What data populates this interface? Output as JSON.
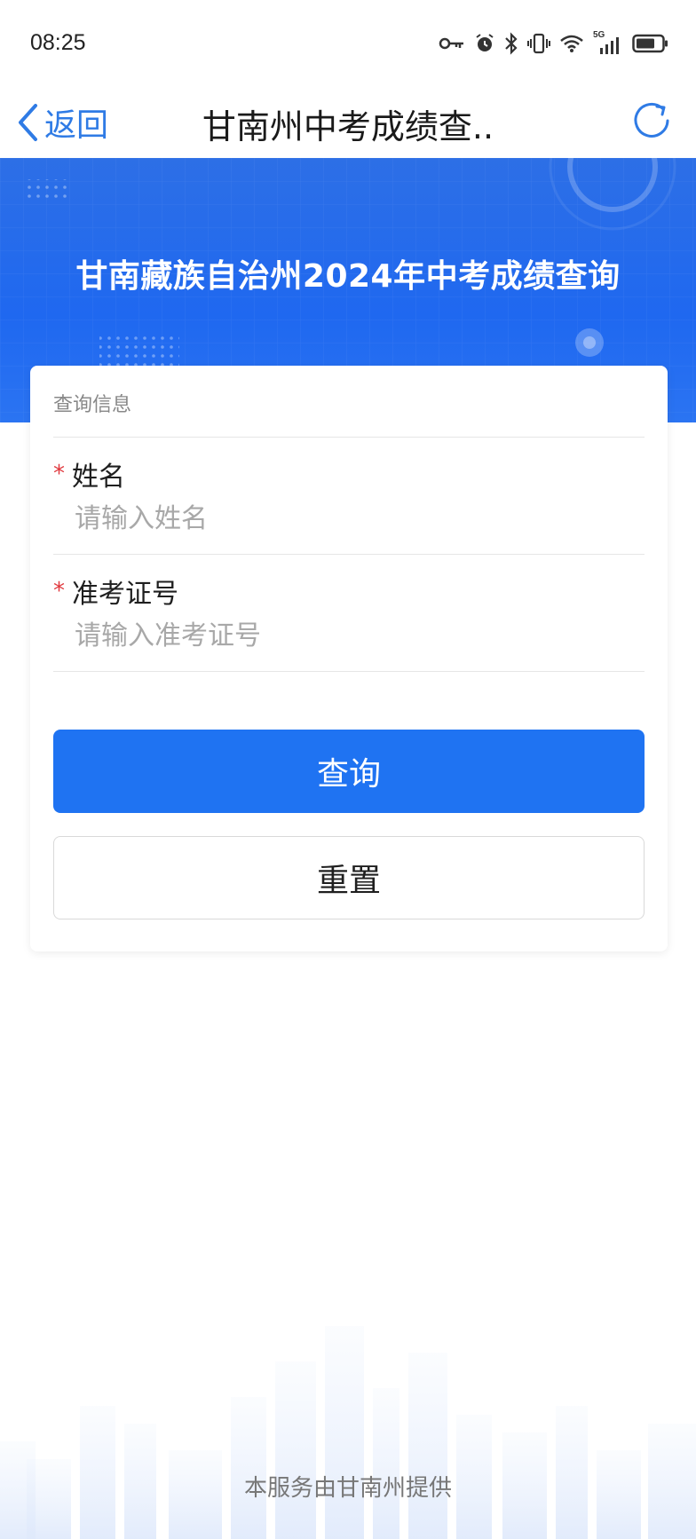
{
  "status_bar": {
    "time": "08:25",
    "network_label": "5G",
    "icons": [
      "key-icon",
      "alarm-icon",
      "bluetooth-icon",
      "vibrate-icon",
      "wifi-icon",
      "signal-icon",
      "battery-icon"
    ]
  },
  "nav": {
    "back_label": "返回",
    "title": "甘南州中考成绩查..",
    "back_icon": "chevron-left-icon",
    "refresh_icon": "refresh-icon"
  },
  "banner": {
    "title": "甘南藏族自治州2024年中考成绩查询"
  },
  "form": {
    "section_title": "查询信息",
    "fields": [
      {
        "required_mark": "*",
        "label": "姓名",
        "value": "",
        "placeholder": "请输入姓名"
      },
      {
        "required_mark": "*",
        "label": "准考证号",
        "value": "",
        "placeholder": "请输入准考证号"
      }
    ],
    "submit_label": "查询",
    "reset_label": "重置"
  },
  "footer": {
    "text": "本服务由甘南州提供"
  },
  "colors": {
    "accent": "#1f73f2",
    "nav_link": "#2f7be5",
    "required": "#e0393e",
    "banner": "#1f68f0"
  }
}
